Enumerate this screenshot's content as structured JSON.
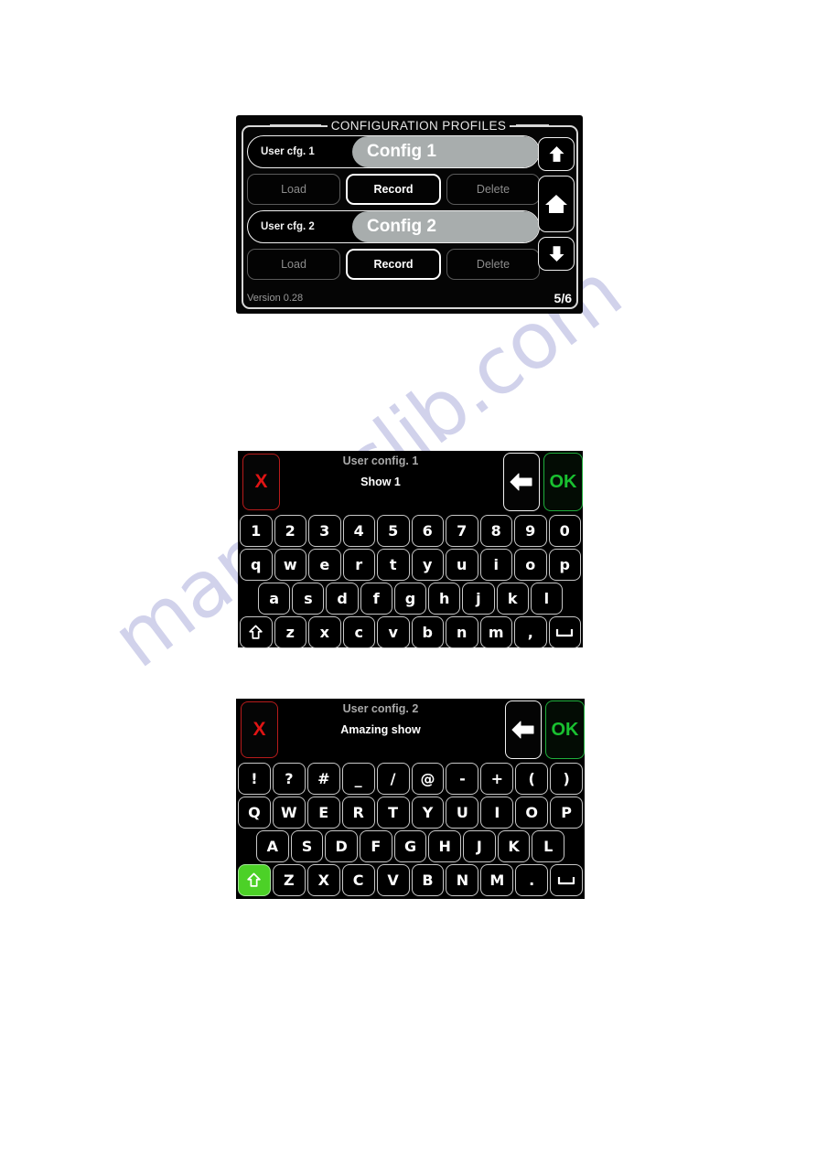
{
  "page": {
    "watermark_text": "manualslib.com",
    "background_color": "#ffffff"
  },
  "config_panel": {
    "title": "CONFIGURATION PROFILES",
    "profiles": [
      {
        "tag": "User cfg. 1",
        "value": "Config 1",
        "actions": [
          {
            "label": "Load",
            "state": "disabled"
          },
          {
            "label": "Record",
            "state": "enabled"
          },
          {
            "label": "Delete",
            "state": "disabled"
          }
        ]
      },
      {
        "tag": "User cfg. 2",
        "value": "Config 2",
        "actions": [
          {
            "label": "Load",
            "state": "disabled"
          },
          {
            "label": "Record",
            "state": "enabled"
          },
          {
            "label": "Delete",
            "state": "disabled"
          }
        ]
      }
    ],
    "footer": {
      "version": "Version 0.28",
      "page_indicator": "5/6"
    },
    "nav": [
      {
        "icon": "arrow-up-icon"
      },
      {
        "icon": "home-icon"
      },
      {
        "icon": "arrow-down-icon"
      }
    ],
    "colors": {
      "frame": "#d8d8d8",
      "value_bg": "#a8adad",
      "enabled_border": "#ffffff",
      "disabled_text": "#8c8c8c"
    }
  },
  "keyboard_lower": {
    "config_label": "User config. 1",
    "value": "Show 1",
    "cancel_label": "X",
    "ok_label": "OK",
    "back_icon": "backspace-arrow-icon",
    "shift_active": false,
    "rows": [
      [
        "1",
        "2",
        "3",
        "4",
        "5",
        "6",
        "7",
        "8",
        "9",
        "0"
      ],
      [
        "q",
        "w",
        "e",
        "r",
        "t",
        "y",
        "u",
        "i",
        "o",
        "p"
      ],
      [
        "a",
        "s",
        "d",
        "f",
        "g",
        "h",
        "j",
        "k",
        "l"
      ],
      [
        "⇧",
        "z",
        "x",
        "c",
        "v",
        "b",
        "n",
        "m",
        ",",
        "␣"
      ]
    ],
    "colors": {
      "cancel": "#e01414",
      "ok": "#19c030",
      "key_border": "#c8c8c8"
    }
  },
  "keyboard_upper": {
    "config_label": "User config. 2",
    "value": "Amazing show",
    "cancel_label": "X",
    "ok_label": "OK",
    "back_icon": "backspace-arrow-icon",
    "shift_active": true,
    "rows": [
      [
        "!",
        "?",
        "#",
        "_",
        "/",
        "@",
        "-",
        "+",
        "(",
        ")"
      ],
      [
        "Q",
        "W",
        "E",
        "R",
        "T",
        "Y",
        "U",
        "I",
        "O",
        "P"
      ],
      [
        "A",
        "S",
        "D",
        "F",
        "G",
        "H",
        "J",
        "K",
        "L"
      ],
      [
        "⇧",
        "Z",
        "X",
        "C",
        "V",
        "B",
        "N",
        "M",
        ".",
        "␣"
      ]
    ],
    "colors": {
      "cancel": "#e01414",
      "ok": "#19c030",
      "shift_active_bg": "#4cd127"
    }
  }
}
